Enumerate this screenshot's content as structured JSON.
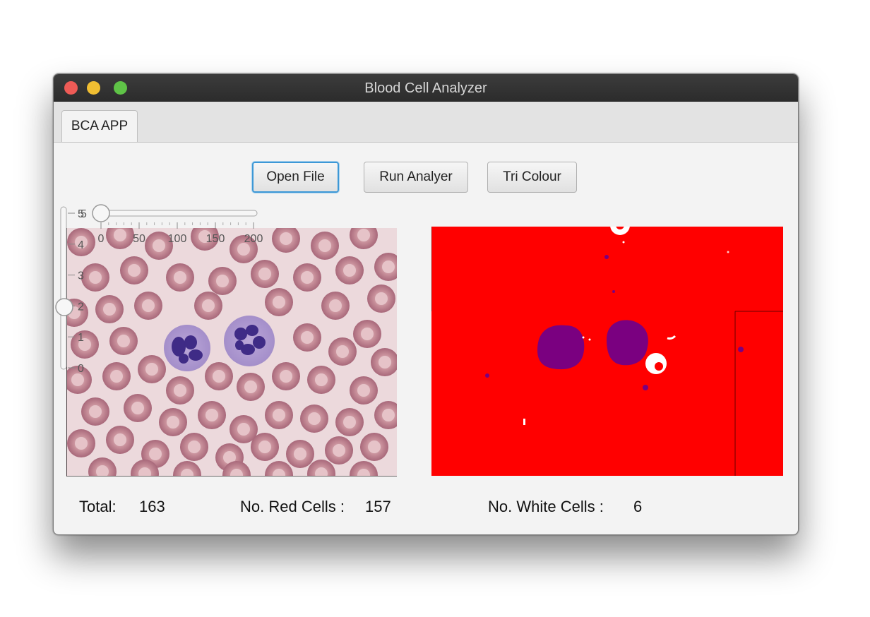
{
  "window": {
    "title": "Blood Cell Analyzer"
  },
  "tabs": [
    {
      "label": "BCA APP",
      "selected": true
    }
  ],
  "toolbar": {
    "open_label": "Open File",
    "run_label": "Run Analyer",
    "tri_label": "Tri Colour"
  },
  "sliders": {
    "horizontal": {
      "ticks": [
        "0",
        "50",
        "100",
        "150",
        "200"
      ],
      "value": 0,
      "min": 0,
      "max": 200
    },
    "vertical": {
      "ticks": [
        "0",
        "1",
        "2",
        "3",
        "4",
        "5"
      ],
      "value": 2,
      "min": 0,
      "max": 5
    },
    "extra_label": "5"
  },
  "images": {
    "original": "blood smear micrograph",
    "result": "tri colour segmentation"
  },
  "stats": {
    "total_label": "Total:",
    "total_value": "163",
    "red_label": "No. Red Cells :",
    "red_value": "157",
    "white_label": "No. White Cells :",
    "white_value": "6"
  },
  "colors": {
    "red_cell_region": "#ff0000",
    "white_cell": "#7a0080",
    "background": "#ffffff",
    "focus_accent": "#3d98d6"
  }
}
